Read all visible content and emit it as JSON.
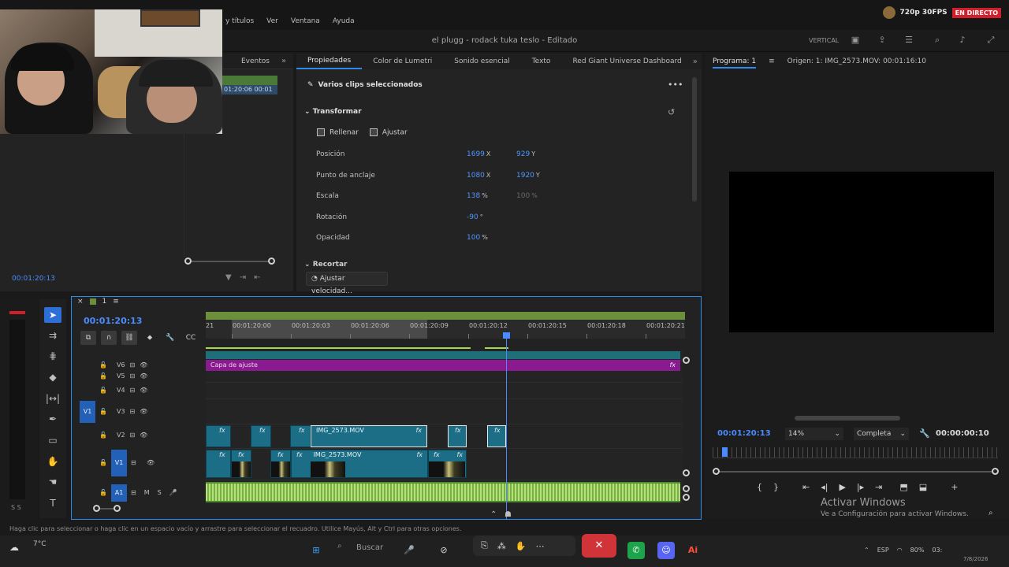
{
  "stream": {
    "quality": "720p 30FPS",
    "live": "EN DIRECTO"
  },
  "menu": [
    "y títulos",
    "Ver",
    "Ventana",
    "Ayuda"
  ],
  "title": "el plugg - rodack tuka teslo - Editado",
  "workspace": "VERTICAL",
  "left_panel": {
    "tab": "Eventos",
    "clip_tc": "01:20:06  00:01",
    "timecode": "00:01:20:13"
  },
  "props": {
    "tabs": [
      "Propiedades",
      "Color de Lumetri",
      "Sonido esencial",
      "Texto",
      "Red Giant Universe Dashboard"
    ],
    "selection": "Varios clips seleccionados",
    "section": "Transformar",
    "fit": [
      "Rellenar",
      "Ajustar"
    ],
    "position": {
      "label": "Posición",
      "x": "1699",
      "y": "929"
    },
    "anchor": {
      "label": "Punto de anclaje",
      "x": "1080",
      "y": "1920"
    },
    "scale": {
      "label": "Escala",
      "v1": "138",
      "v2": "100"
    },
    "rotation": {
      "label": "Rotación",
      "v": "-90"
    },
    "opacity": {
      "label": "Opacidad",
      "v": "100"
    },
    "next_section": "Recortar",
    "speed_btn": "Ajustar velocidad..."
  },
  "program": {
    "tab": "Programa: 1",
    "source": "Origen: 1: IMG_2573.MOV: 00:01:16:10",
    "timecode": "00:01:20:13",
    "zoom": "14%",
    "quality": "Completa",
    "duration": "00:00:00:10"
  },
  "activate": {
    "title": "Activar Windows",
    "sub": "Ve a Configuración para activar Windows."
  },
  "timeline": {
    "seq": "1",
    "timecode": "00:01:20:13",
    "ticks": [
      "21",
      "00:01:20:00",
      "00:01:20:03",
      "00:01:20:06",
      "00:01:20:09",
      "00:01:20:12",
      "00:01:20:15",
      "00:01:20:18",
      "00:01:20:21"
    ],
    "adjust_clip": "Capa de ajuste",
    "clip_v2": "IMG_2573.MOV",
    "clip_v1": "IMG_2573.MOV",
    "tracks": [
      "V6",
      "V5",
      "V4",
      "V3",
      "V2",
      "V1",
      "A1"
    ],
    "src_v1": "V1",
    "fx": "fx"
  },
  "status": "Haga clic para seleccionar o haga clic en un espacio vacío y arrastre para seleccionar el recuadro. Utilice Mayús, Alt y Ctrl para otras opciones.",
  "meter_label": "S S",
  "taskbar": {
    "weather_temp": "7°C",
    "search": "Buscar",
    "lang": "ESP",
    "battery": "80%",
    "time": "03:",
    "date": "7/8/2026"
  }
}
